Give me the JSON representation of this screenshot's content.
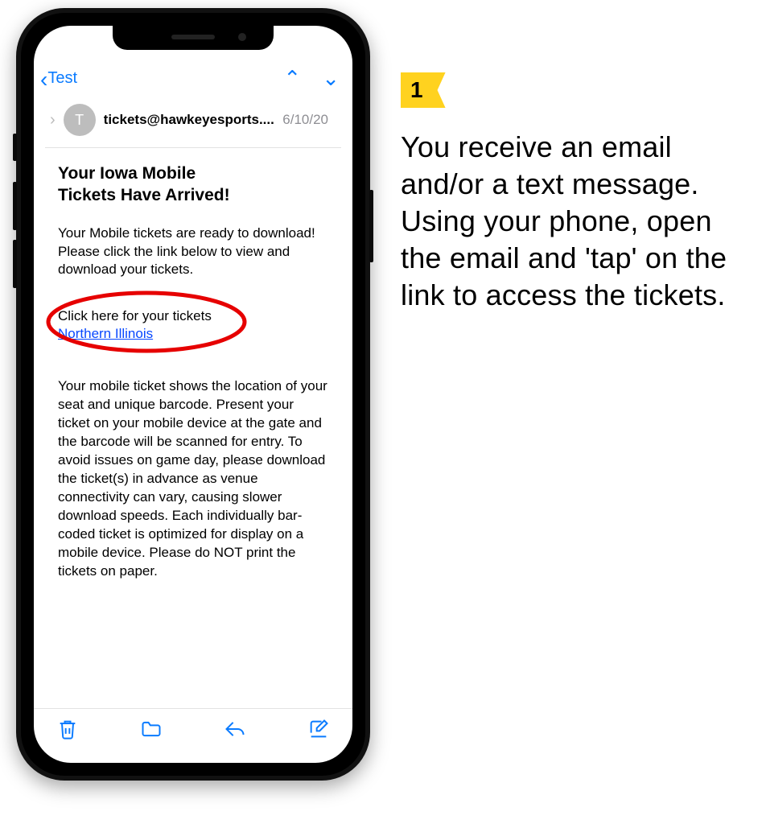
{
  "step": {
    "number": "1",
    "text": "You receive an email and/or a text message. Using your phone, open the email and 'tap' on the link to access the tickets."
  },
  "mail": {
    "back_label": "Test",
    "avatar_initial": "T",
    "sender": "tickets@hawkeyesports....",
    "date": "6/10/20",
    "title_line1": "Your Iowa Mobile",
    "title_line2": "Tickets Have Arrived!",
    "intro": "Your Mobile tickets are ready to download! Please click the link below to view and download your tickets.",
    "link_label": "Click here for your tickets",
    "link_text": "Northern Illinois",
    "body": "Your mobile ticket shows the location of your seat and unique barcode. Present your ticket on your mobile device at the gate and the barcode will be scanned for entry. To avoid issues on game day, please download the ticket(s) in advance as venue connectivity can vary, causing slower download speeds. Each individually bar-coded ticket is optimized for display on a mobile device. Please do NOT print the tickets on paper."
  },
  "colors": {
    "ios_blue": "#0a7bff",
    "flag_yellow": "#ffd21f",
    "annotation_red": "#e60000"
  }
}
